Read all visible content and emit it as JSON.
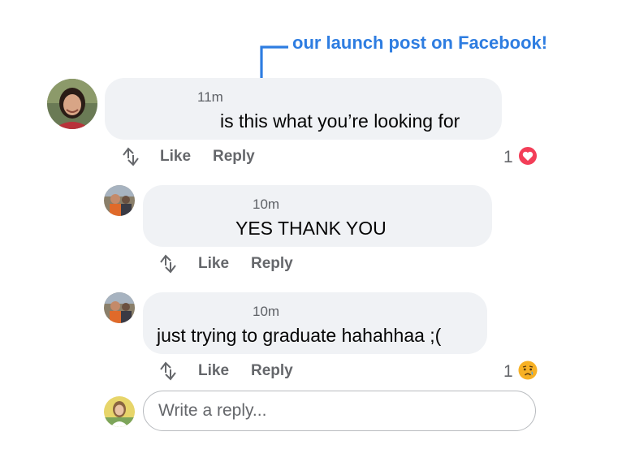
{
  "annotation": {
    "text": "our launch post on Facebook!",
    "color": "#2e7de1"
  },
  "comments": [
    {
      "timestamp": "11m",
      "text": "is this what you’re looking for",
      "actions": {
        "like": "Like",
        "reply": "Reply"
      },
      "reaction": {
        "count": "1",
        "type": "heart-icon",
        "color": "#f33e58"
      }
    },
    {
      "timestamp": "10m",
      "text": "YES THANK YOU",
      "actions": {
        "like": "Like",
        "reply": "Reply"
      }
    },
    {
      "timestamp": "10m",
      "text": "just trying to graduate hahahhaa ;(",
      "actions": {
        "like": "Like",
        "reply": "Reply"
      },
      "reaction": {
        "count": "1",
        "type": "sad-tear-emoji-icon",
        "color": "#f7b125"
      }
    }
  ],
  "reply_box": {
    "placeholder": "Write a reply..."
  },
  "colors": {
    "bubble": "#f0f2f5",
    "action_text": "#65676b",
    "input_border": "#b8bbbf"
  }
}
